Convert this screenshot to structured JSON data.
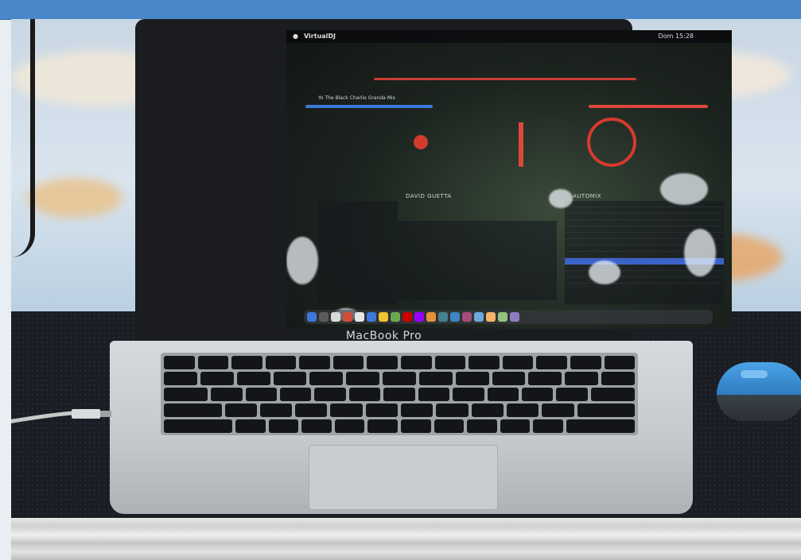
{
  "photo": {
    "laptop_label": "MacBook Pro",
    "screen": {
      "menubar_app": "VirtualDJ",
      "menubar_clock": "Dom 15:28",
      "left_deck_track": "Yo The Black Charlie Granda Mix",
      "browser_left_header": "DAVID GUETTA",
      "browser_right_header": "AUTOMIX"
    },
    "objects": [
      "laptop-icon",
      "keyboard",
      "trackpad",
      "usb-cable",
      "wireless-mouse",
      "sky-window",
      "metal-rail"
    ]
  }
}
